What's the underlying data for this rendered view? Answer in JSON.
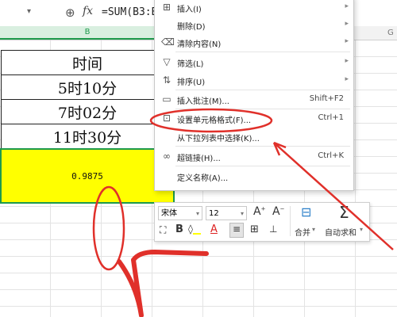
{
  "formula_bar": {
    "formula": "=SUM(B3:B",
    "fx_label": "fx"
  },
  "columns": {
    "b": "B",
    "g": "G"
  },
  "table": {
    "rows": [
      "时间",
      "5时10分",
      "7时02分",
      "11时30分"
    ],
    "result": "0.9875",
    "result_color": "#ffff00",
    "selection_color": "#1e9a4c"
  },
  "context_menu": {
    "items": [
      {
        "label": "插入(I)",
        "icon": "insert-icon",
        "submenu": true
      },
      {
        "label": "删除(D)",
        "icon": "",
        "submenu": true
      },
      {
        "label": "清除内容(N)",
        "icon": "eraser-icon",
        "submenu": true
      },
      {
        "label": "筛选(L)",
        "icon": "filter-icon",
        "submenu": true
      },
      {
        "label": "排序(U)",
        "icon": "sort-icon",
        "submenu": true
      },
      {
        "label": "插入批注(M)...",
        "icon": "comment-icon",
        "shortcut": "Shift+F2"
      },
      {
        "label": "设置单元格格式(F)...",
        "icon": "format-cells-icon",
        "shortcut": "Ctrl+1"
      },
      {
        "label": "从下拉列表中选择(K)...",
        "icon": ""
      },
      {
        "label": "超链接(H)...",
        "icon": "hyperlink-icon",
        "shortcut": "Ctrl+K"
      },
      {
        "label": "定义名称(A)...",
        "icon": ""
      }
    ]
  },
  "mini_toolbar": {
    "font": "宋体",
    "size": "12",
    "bold": "B",
    "font_color_letter": "A",
    "merge_label": "合并",
    "autosum_label": "自动求和",
    "dropdown_arrow": "▾"
  },
  "annotation_color": "#e0302a"
}
